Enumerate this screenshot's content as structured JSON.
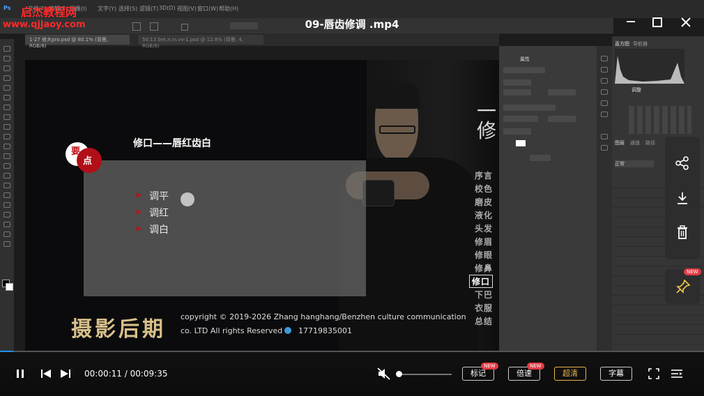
{
  "watermark": {
    "site_name": "启杰教程网",
    "site_url": "www.qjjaoy.com"
  },
  "player": {
    "title": "09-唇齿修调 .mp4",
    "time": "00:00:11 / 00:09:35",
    "progress_fraction": 0.019,
    "buttons": {
      "mark": "标记",
      "speed": "倍速",
      "quality": "超清",
      "subtitle": "字幕"
    },
    "new_badge": "NEW",
    "accent_color": "#1e90ff",
    "highlight_color": "#e8b64a"
  },
  "ps_menu": [
    "文件(F)",
    "编辑(E)",
    "图像(I)",
    "图层(L)",
    "文字(Y)",
    "选择(S)",
    "滤镜(T)",
    "3D(D)",
    "视图(V)",
    "窗口(W)",
    "帮助(H)"
  ],
  "ps_tabs": [
    "1-27 修大pro.psd @ 80.1% (背景, RGB/8)",
    "50:13 bet.n.in.vv-1.psd @ 12.8% (背景, 4, RGB/8)"
  ],
  "slide": {
    "heading": "修口——唇红齿白",
    "badge_top": "要",
    "badge_bottom": "点",
    "bullets": [
      "调平",
      "调红",
      "调白"
    ],
    "vertical_title": "一修",
    "side_menu": [
      "序言",
      "校色",
      "磨皮",
      "液化",
      "头发",
      "修眉",
      "修眼",
      "修鼻",
      "修口",
      "下巴",
      "衣服",
      "总结"
    ],
    "active_side_item": "修口",
    "logo": "摄影后期",
    "copyright_line1": "copyright © 2019-2026 Zhang hanghang/Benzhen culture communication",
    "copyright_line2": "co. LTD All rights Reserved",
    "phone": "17719835001"
  },
  "ps_panels": {
    "histogram_tab": "直方图",
    "nav_tab": "导航器",
    "layers_tabs": [
      "图层",
      "通道",
      "路径"
    ],
    "blend_mode": "正常",
    "properties_tab": "属性",
    "adjust_tab": "调整"
  }
}
